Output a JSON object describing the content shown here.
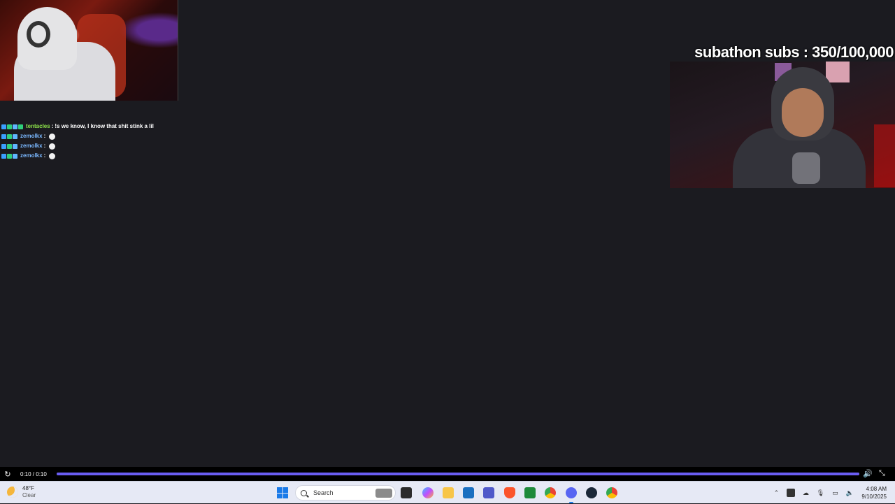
{
  "overlay": {
    "subathon_text": "subathon subs : 350/100,000"
  },
  "chat": {
    "messages": [
      {
        "user": "tentacles",
        "sep": " :",
        "text": " !s we know, I know that shit stink a lil"
      },
      {
        "user": "zemolkx",
        "sep": " :",
        "text": ""
      },
      {
        "user": "zemolkx",
        "sep": " :",
        "text": ""
      },
      {
        "user": "zemolkx",
        "sep": " :",
        "text": ""
      }
    ]
  },
  "player": {
    "time": "0:10 / 0:10",
    "progress": 1.0,
    "accent": "#6a5df3"
  },
  "taskbar": {
    "weather_temp": "48°F",
    "weather_cond": "Clear",
    "search_placeholder": "Search",
    "clock_time": "4:08 AM",
    "clock_date": "9/10/2025",
    "apps": [
      "task-view",
      "file-explorer",
      "copilot",
      "folder",
      "store",
      "teams",
      "brave",
      "android",
      "chrome",
      "discord",
      "steam",
      "chrome-2"
    ]
  }
}
